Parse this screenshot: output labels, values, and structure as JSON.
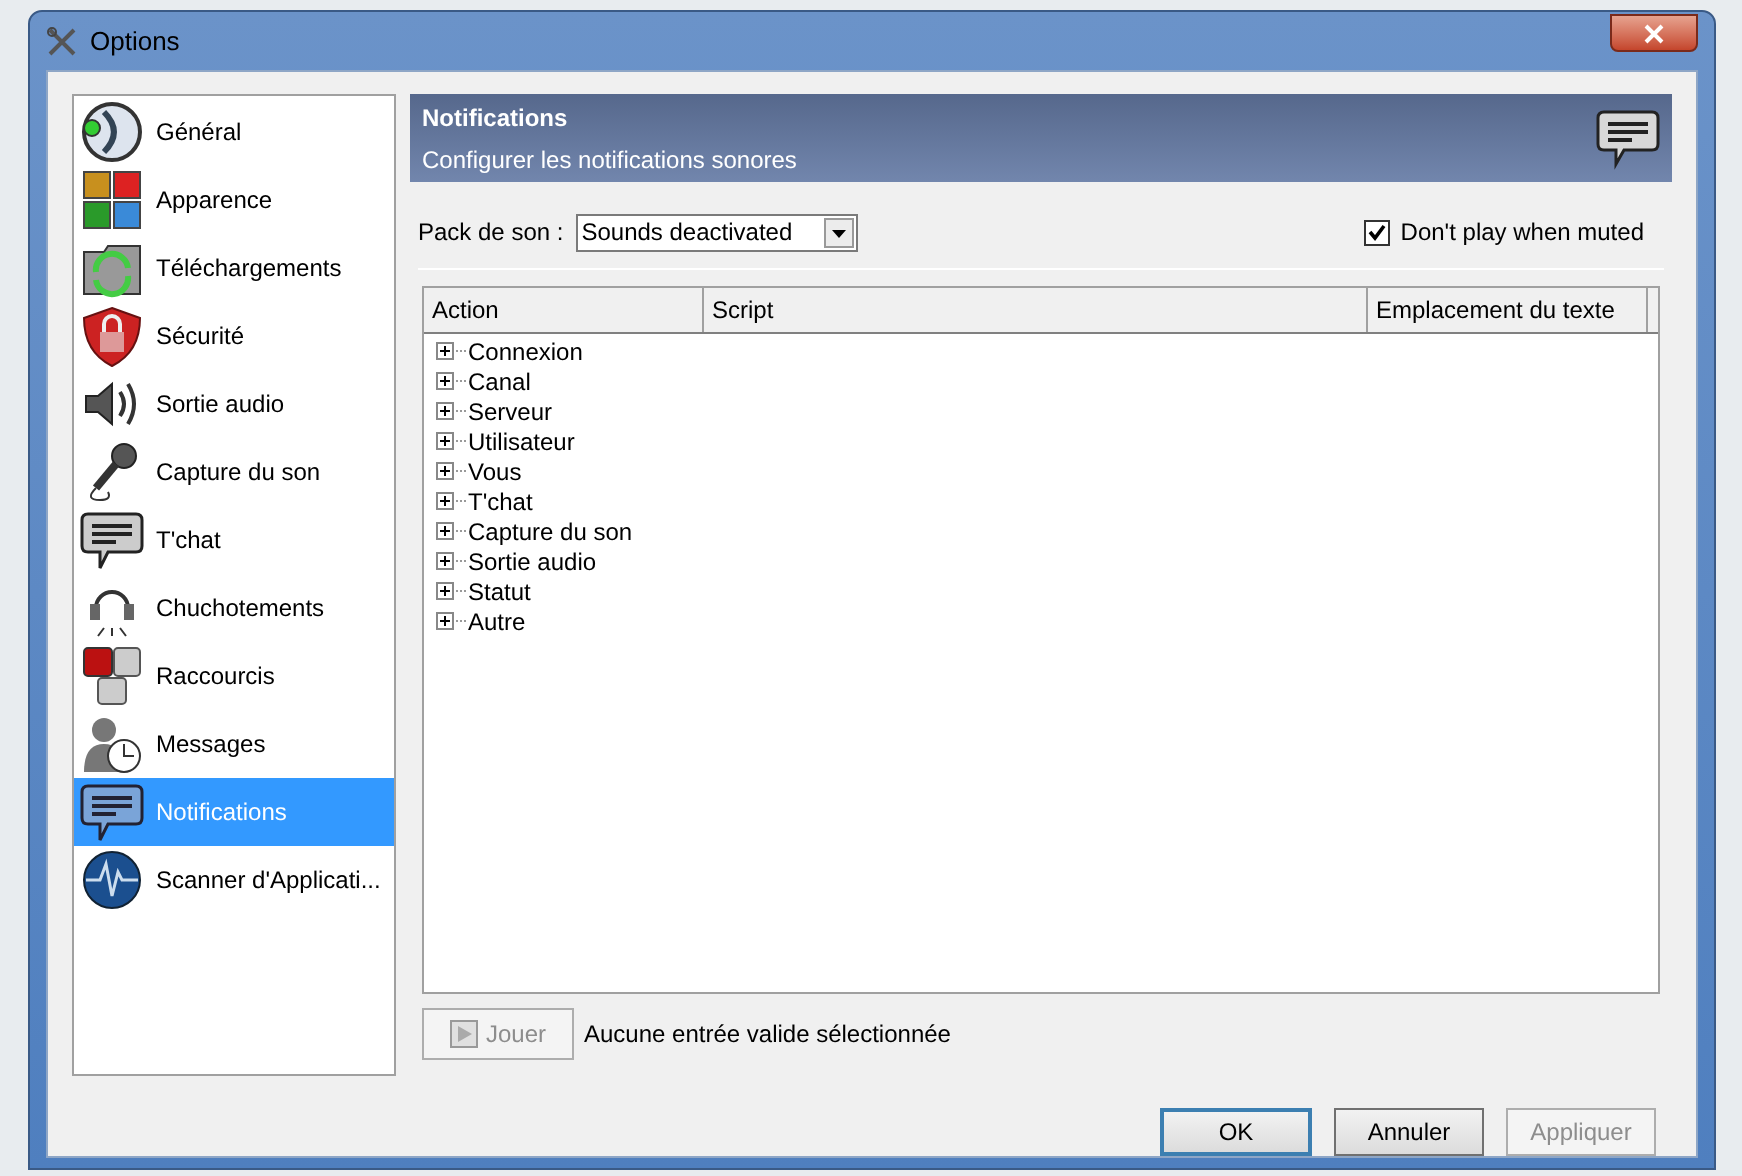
{
  "window": {
    "title": "Options"
  },
  "sidebar": {
    "items": [
      {
        "label": "Général",
        "selected": false
      },
      {
        "label": "Apparence",
        "selected": false
      },
      {
        "label": "Téléchargements",
        "selected": false
      },
      {
        "label": "Sécurité",
        "selected": false
      },
      {
        "label": "Sortie audio",
        "selected": false
      },
      {
        "label": "Capture du son",
        "selected": false
      },
      {
        "label": "T'chat",
        "selected": false
      },
      {
        "label": "Chuchotements",
        "selected": false
      },
      {
        "label": "Raccourcis",
        "selected": false
      },
      {
        "label": "Messages",
        "selected": false
      },
      {
        "label": "Notifications",
        "selected": true
      },
      {
        "label": "Scanner d'Applicati...",
        "selected": false
      }
    ]
  },
  "header": {
    "title": "Notifications",
    "subtitle": "Configurer les notifications sonores"
  },
  "sound_pack": {
    "label": "Pack de son :",
    "value": "Sounds deactivated"
  },
  "mute_option": {
    "label": "Don't play when muted",
    "checked": true
  },
  "table": {
    "columns": [
      "Action",
      "Script",
      "Emplacement du texte"
    ],
    "rows": [
      {
        "label": "Connexion",
        "expanded": false
      },
      {
        "label": "Canal",
        "expanded": false
      },
      {
        "label": "Serveur",
        "expanded": false
      },
      {
        "label": "Utilisateur",
        "expanded": false
      },
      {
        "label": "Vous",
        "expanded": false
      },
      {
        "label": "T'chat",
        "expanded": false
      },
      {
        "label": "Capture du son",
        "expanded": false
      },
      {
        "label": "Sortie audio",
        "expanded": false
      },
      {
        "label": "Statut",
        "expanded": false
      },
      {
        "label": "Autre",
        "expanded": false
      }
    ]
  },
  "play_button": {
    "label": "Jouer",
    "disabled": true
  },
  "status_text": "Aucune entrée valide sélectionnée",
  "buttons": [
    {
      "label": "OK",
      "disabled": false
    },
    {
      "label": "Annuler",
      "disabled": false
    },
    {
      "label": "Appliquer",
      "disabled": true
    }
  ]
}
